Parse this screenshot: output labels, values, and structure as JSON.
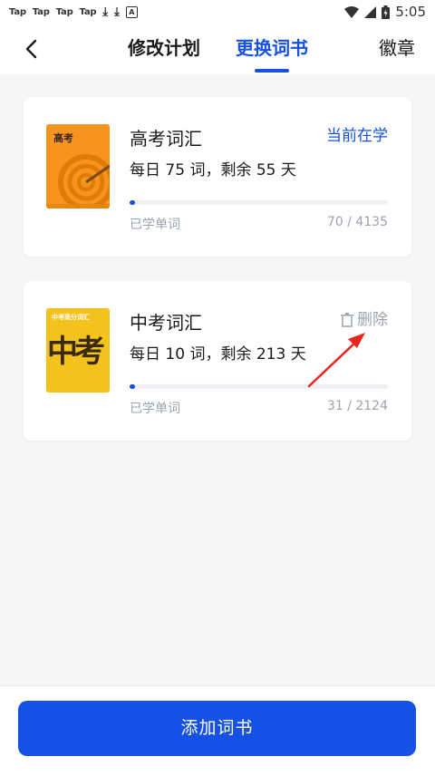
{
  "status_bar": {
    "apps": [
      "Tap",
      "Tap",
      "Tap",
      "Tap"
    ],
    "time": "5:05"
  },
  "nav": {
    "tabs": [
      {
        "label": "修改计划"
      },
      {
        "label": "更换词书",
        "active": true
      },
      {
        "label": "徽章"
      }
    ]
  },
  "books": [
    {
      "cover_text": "高考",
      "title": "高考词汇",
      "daily": "每日 75 词，剩余 55 天",
      "status": "当前在学",
      "progress_label": "已学单词",
      "learned": 70,
      "total": 4135,
      "progress_text": "70 / 4135"
    },
    {
      "cover_text": "中考",
      "cover_subtitle": "中考高分词汇",
      "title": "中考词汇",
      "daily": "每日 10 词，剩余 213 天",
      "action": "删除",
      "progress_label": "已学单词",
      "learned": 31,
      "total": 2124,
      "progress_text": "31 / 2124"
    }
  ],
  "add_button": "添加词书",
  "colors": {
    "accent": "#1651e6",
    "muted": "#9aa3b1",
    "annotation": "#e8261f",
    "cover1": "#f7941d",
    "cover2": "#f4c21d"
  }
}
